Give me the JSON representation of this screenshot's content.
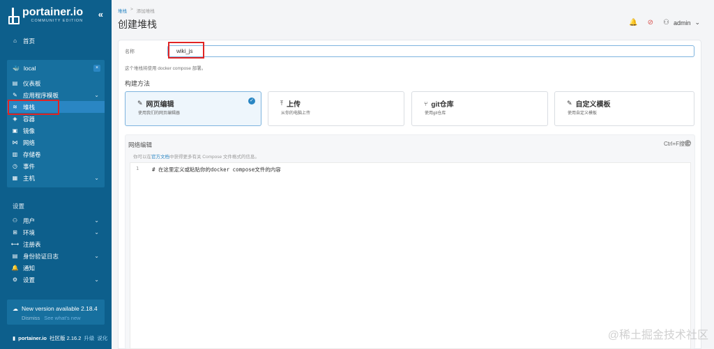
{
  "colors": {
    "sidebar": "#0d5f8c",
    "sidebar_active": "#2a86c3",
    "accent": "#2a86c3",
    "highlight_box": "#e02424"
  },
  "sidebar": {
    "logo_title": "portainer.io",
    "logo_sub": "COMMUNITY EDITION",
    "collapse": "«",
    "home": "首页",
    "environment": {
      "name": "local",
      "close": "×"
    },
    "env_items": [
      {
        "label": "仪表板",
        "icon": "dashboard-icon",
        "glyph": "▤"
      },
      {
        "label": "应用程序模板",
        "icon": "templates-icon",
        "glyph": "✎",
        "chevron": "⌄"
      },
      {
        "label": "堆栈",
        "icon": "stacks-icon",
        "glyph": "≋",
        "active": true
      },
      {
        "label": "容器",
        "icon": "containers-icon",
        "glyph": "◈"
      },
      {
        "label": "镜像",
        "icon": "images-icon",
        "glyph": "▣"
      },
      {
        "label": "网络",
        "icon": "networks-icon",
        "glyph": "⋈"
      },
      {
        "label": "存储卷",
        "icon": "volumes-icon",
        "glyph": "▥"
      },
      {
        "label": "事件",
        "icon": "events-icon",
        "glyph": "◷"
      },
      {
        "label": "主机",
        "icon": "host-icon",
        "glyph": "▦",
        "chevron": "⌄"
      }
    ],
    "settings_label": "设置",
    "settings_items": [
      {
        "label": "用户",
        "icon": "users-icon",
        "glyph": "⚇",
        "chevron": "⌄"
      },
      {
        "label": "环境",
        "icon": "environments-icon",
        "glyph": "⊞",
        "chevron": "⌄"
      },
      {
        "label": "注册表",
        "icon": "registries-icon",
        "glyph": "⟷"
      },
      {
        "label": "身份验证日志",
        "icon": "auth-logs-icon",
        "glyph": "▤",
        "chevron": "⌄"
      },
      {
        "label": "通知",
        "icon": "notifications-icon",
        "glyph": "🔔"
      },
      {
        "label": "设置",
        "icon": "settings-icon",
        "glyph": "⚙",
        "chevron": "⌄"
      }
    ],
    "update": {
      "title": "New version available 2.18.4",
      "dismiss": "Dismiss",
      "see_new": "See what's new"
    },
    "footer": {
      "brand": "portainer.io",
      "edition": "社区版 2.16.2",
      "upgrade": "升级",
      "more": "说化"
    }
  },
  "header": {
    "breadcrumb_link": "堆栈",
    "breadcrumb_sep": ">",
    "breadcrumb_current": "添加堆栈",
    "title": "创建堆栈",
    "user": "admin"
  },
  "form": {
    "name_label": "名称",
    "name_value": "wiki_js",
    "hint": "这个堆栈将使用 docker compose 部署。",
    "build_label": "构建方法",
    "methods": [
      {
        "title": "网页编辑",
        "desc": "使用我们的网页编辑器",
        "icon": "edit-icon",
        "glyph": "✎",
        "selected": true
      },
      {
        "title": "上传",
        "desc": "从你的电脑上传",
        "icon": "upload-icon",
        "glyph": "⤒"
      },
      {
        "title": "git仓库",
        "desc": "使用git仓库",
        "icon": "git-icon",
        "glyph": "⑂"
      },
      {
        "title": "自定义模板",
        "desc": "使用自定义模板",
        "icon": "custom-template-icon",
        "glyph": "✎"
      }
    ],
    "editor": {
      "title": "网络编辑",
      "help_prefix": "你可以在",
      "help_link": "官方文档",
      "help_suffix": "中获得更多有关 Compose 文件格式的信息。",
      "shortcut": "Ctrl+F搜索",
      "line_number": "1",
      "code": "# 在这里定义或粘贴你的docker compose文件的内容"
    }
  },
  "watermark": "@稀土掘金技术社区"
}
